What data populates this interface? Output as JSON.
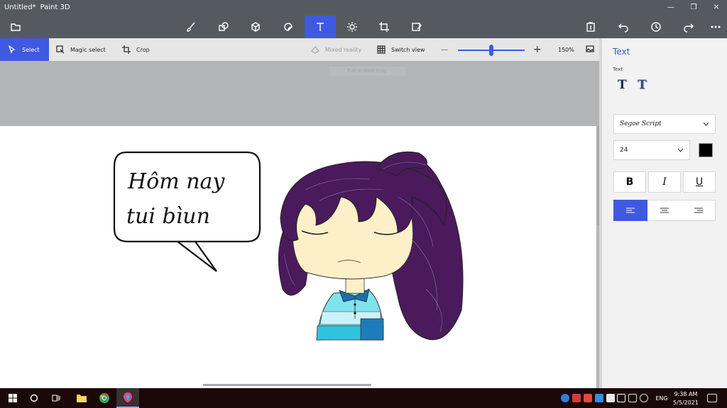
{
  "window": {
    "doc_title": "Untitled*",
    "app_name": "Paint 3D",
    "minimize_glyph": "—",
    "maximize_glyph": "❐",
    "close_glyph": "✕"
  },
  "command_bar": {
    "active_tool": "text",
    "tools": [
      "menu-icon",
      "brushes-icon",
      "2d-shapes-icon",
      "3d-shapes-icon",
      "stickers-icon",
      "text-icon",
      "effects-icon",
      "canvas-icon",
      "3d-library-icon"
    ],
    "right_tools": [
      "paste-icon",
      "undo-icon",
      "history-icon",
      "redo-icon",
      "more-icon"
    ],
    "accent": "#3f5ae0"
  },
  "toolbar": {
    "select_label": "Select",
    "magic_select_label": "Magic select",
    "crop_label": "Crop",
    "mixed_reality_label": "Mixed reality",
    "switch_view_label": "Switch view",
    "zoom_minus": "—",
    "zoom_plus": "+",
    "zoom_value": 0.5,
    "zoom_label": "150%",
    "snip_label": "Full-screen Snip"
  },
  "canvas": {
    "bubble_line1": "Hôm nay",
    "bubble_line2": "tui bìun"
  },
  "text_panel": {
    "title": "Text",
    "section_label": "Text",
    "font_name": "Segoe Script",
    "font_size": "24",
    "text_color": "#000000",
    "bold_label": "B",
    "italic_label": "I",
    "underline_label": "U",
    "text_2d_glyph": "T",
    "text_3d_glyph": "T"
  },
  "taskbar": {
    "language": "ENG",
    "time": "9:38 AM",
    "date": "5/5/2021"
  }
}
